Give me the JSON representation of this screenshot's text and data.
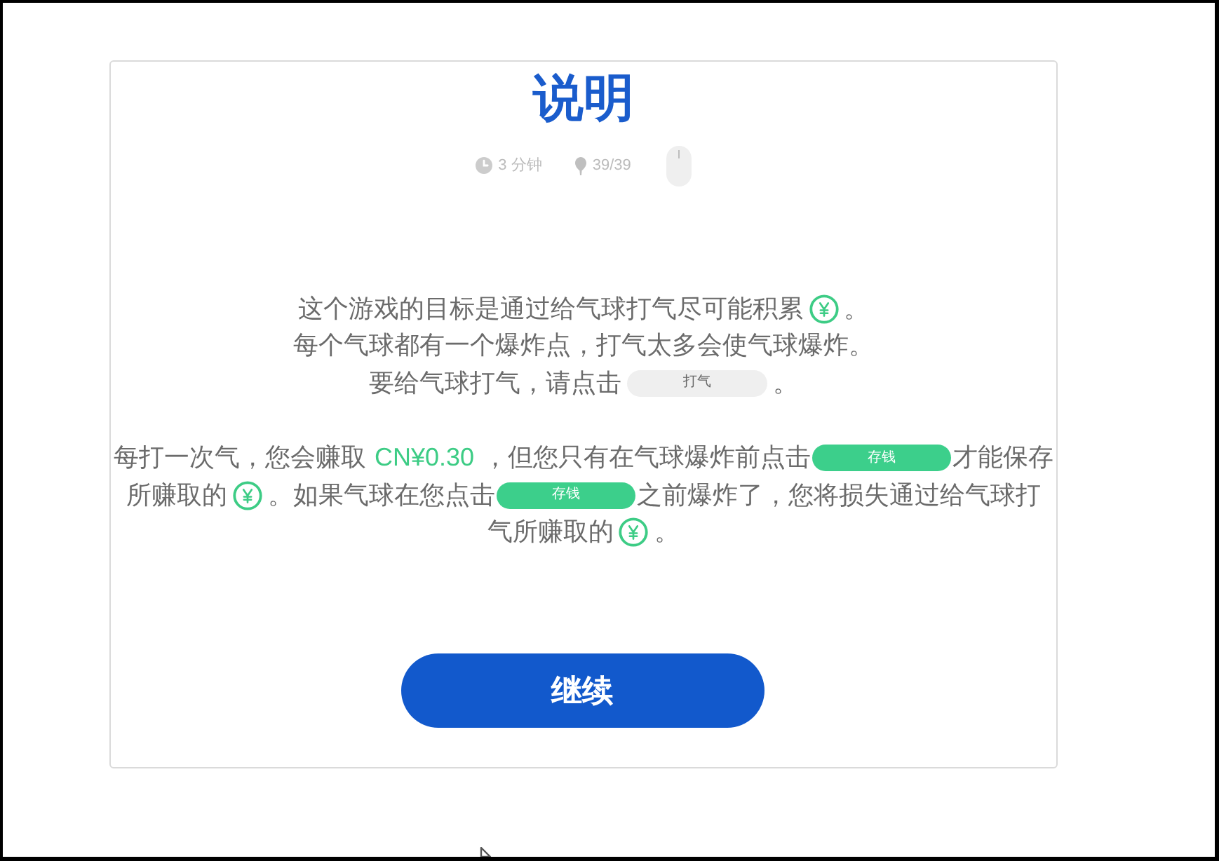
{
  "title": "说明",
  "meta": [
    {
      "kind": "time",
      "text": "3 分钟"
    },
    {
      "kind": "balloons",
      "text": "39/39"
    },
    {
      "kind": "mouse"
    }
  ],
  "paragraphs": [
    {
      "lines": [
        [
          {
            "kind": "text",
            "text": "这个游戏的目标是通过给气球打气尽可能积累"
          },
          {
            "kind": "coin"
          },
          {
            "kind": "text",
            "text": "。"
          }
        ],
        [
          {
            "kind": "text",
            "text": "每个气球都有一个爆炸点，打气太多会使气球爆炸。"
          }
        ],
        [
          {
            "kind": "text",
            "text": "要给气球打气，请点击"
          },
          {
            "kind": "pump_button",
            "label": "打气"
          },
          {
            "kind": "text",
            "text": "。"
          }
        ]
      ]
    },
    {
      "lines": [
        [
          {
            "kind": "text",
            "text": "每打一次气，您会赚取"
          },
          {
            "kind": "amount",
            "text": "CN¥0.30"
          },
          {
            "kind": "text",
            "text": "，但您只有在气球爆炸前点击"
          },
          {
            "kind": "save_button",
            "label": "存钱"
          },
          {
            "kind": "text",
            "text": "才能保存"
          }
        ],
        [
          {
            "kind": "text",
            "text": "所赚取的"
          },
          {
            "kind": "coin"
          },
          {
            "kind": "text",
            "text": "。如果气球在您点击"
          },
          {
            "kind": "save_button",
            "label": "存钱"
          },
          {
            "kind": "text",
            "text": "之前爆炸了，您将损失通过给气球打"
          }
        ],
        [
          {
            "kind": "text",
            "text": "气所赚取的"
          },
          {
            "kind": "coin"
          },
          {
            "kind": "text",
            "text": "。"
          }
        ]
      ]
    }
  ],
  "continue_button": "继续"
}
